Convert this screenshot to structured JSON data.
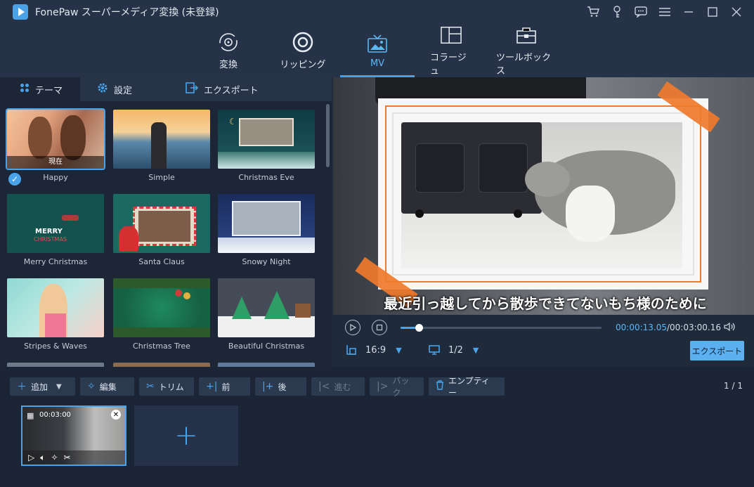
{
  "app": {
    "title": "FonePaw スーパーメディア変換 (未登録)"
  },
  "title_icons": [
    "cart-icon",
    "key-icon",
    "chat-icon",
    "menu-icon",
    "minimize-icon",
    "maximize-icon",
    "close-icon"
  ],
  "nav": {
    "items": [
      {
        "label": "変換",
        "icon": "convert-icon"
      },
      {
        "label": "リッピング",
        "icon": "disc-icon"
      },
      {
        "label": "MV",
        "icon": "mv-icon",
        "active": true
      },
      {
        "label": "コラージュ",
        "icon": "collage-icon"
      },
      {
        "label": "ツールボックス",
        "icon": "toolbox-icon"
      }
    ]
  },
  "subtabs": [
    {
      "label": "テーマ",
      "icon": "grid-icon",
      "active": true
    },
    {
      "label": "設定",
      "icon": "gear-icon"
    },
    {
      "label": "エクスポート",
      "icon": "export-icon"
    }
  ],
  "themes": [
    {
      "label": "Happy",
      "selected": true,
      "badge": "現在"
    },
    {
      "label": "Simple"
    },
    {
      "label": "Christmas Eve"
    },
    {
      "label": "Merry Christmas"
    },
    {
      "label": "Santa Claus"
    },
    {
      "label": "Snowy Night"
    },
    {
      "label": "Stripes & Waves"
    },
    {
      "label": "Christmas Tree"
    },
    {
      "label": "Beautiful Christmas"
    }
  ],
  "preview": {
    "subtitle": "最近引っ越してから散歩できてないもち様のために"
  },
  "player": {
    "current_time": "00:00:13.05",
    "total_time": "/00:03:00.16",
    "progress": 0.09,
    "aspect_ratio": "16:9",
    "screen": "1/2",
    "export_label": "エクスポート"
  },
  "toolbar": {
    "add": "追加",
    "edit": "編集",
    "trim": "トリム",
    "forward": "前",
    "backward": "後",
    "advance": "進む",
    "back": "バック",
    "empty": "エンプティー",
    "page": "1 / 1"
  },
  "clip": {
    "duration": "00:03:00"
  },
  "colors": {
    "accent": "#4aa3e8",
    "frame_orange": "#f07a2c"
  }
}
